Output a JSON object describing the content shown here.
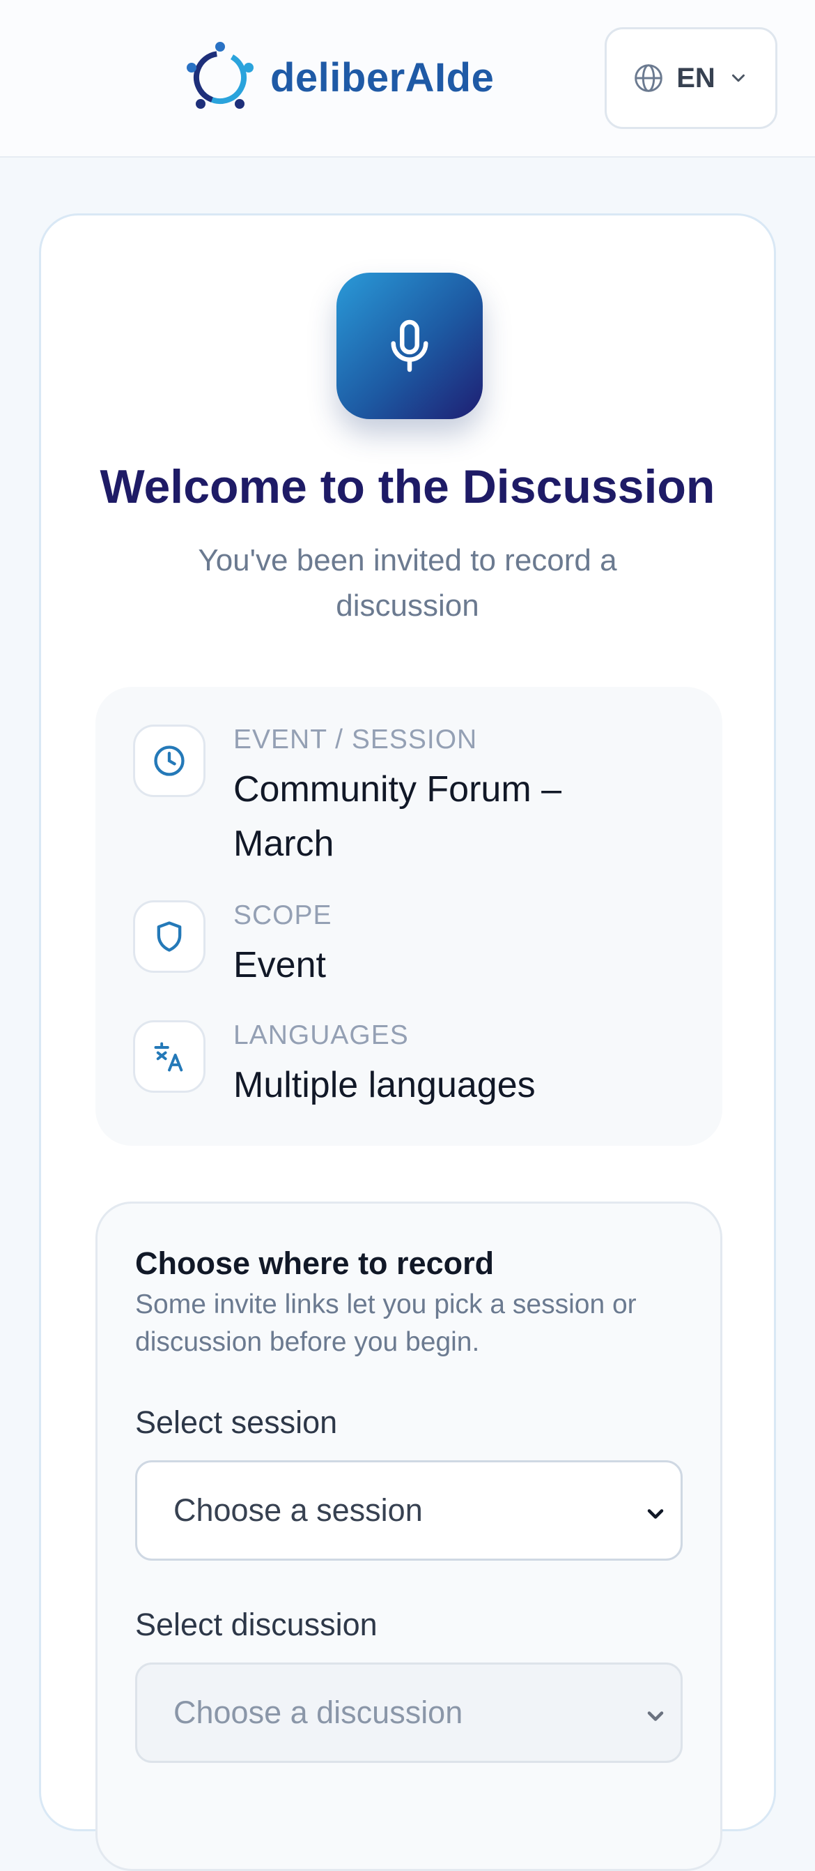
{
  "header": {
    "brand_name": "deliberAIde",
    "language": {
      "code": "EN"
    }
  },
  "welcome": {
    "title": "Welcome to the Discussion",
    "subtitle": "You've been invited to record a discussion"
  },
  "info": {
    "event": {
      "label": "EVENT / SESSION",
      "value": "Community Forum – March",
      "icon": "clock-icon"
    },
    "scope": {
      "label": "SCOPE",
      "value": "Event",
      "icon": "shield-icon"
    },
    "languages": {
      "label": "LANGUAGES",
      "value": "Multiple languages",
      "icon": "translate-icon"
    }
  },
  "record": {
    "title": "Choose where to record",
    "description": "Some invite links let you pick a session or discussion before you begin.",
    "session": {
      "label": "Select session",
      "placeholder": "Choose a session"
    },
    "discussion": {
      "label": "Select discussion",
      "placeholder": "Choose a discussion"
    }
  },
  "colors": {
    "brand": "#1f5aa6",
    "title": "#1e1b66",
    "accent_icon": "#2479b8"
  }
}
